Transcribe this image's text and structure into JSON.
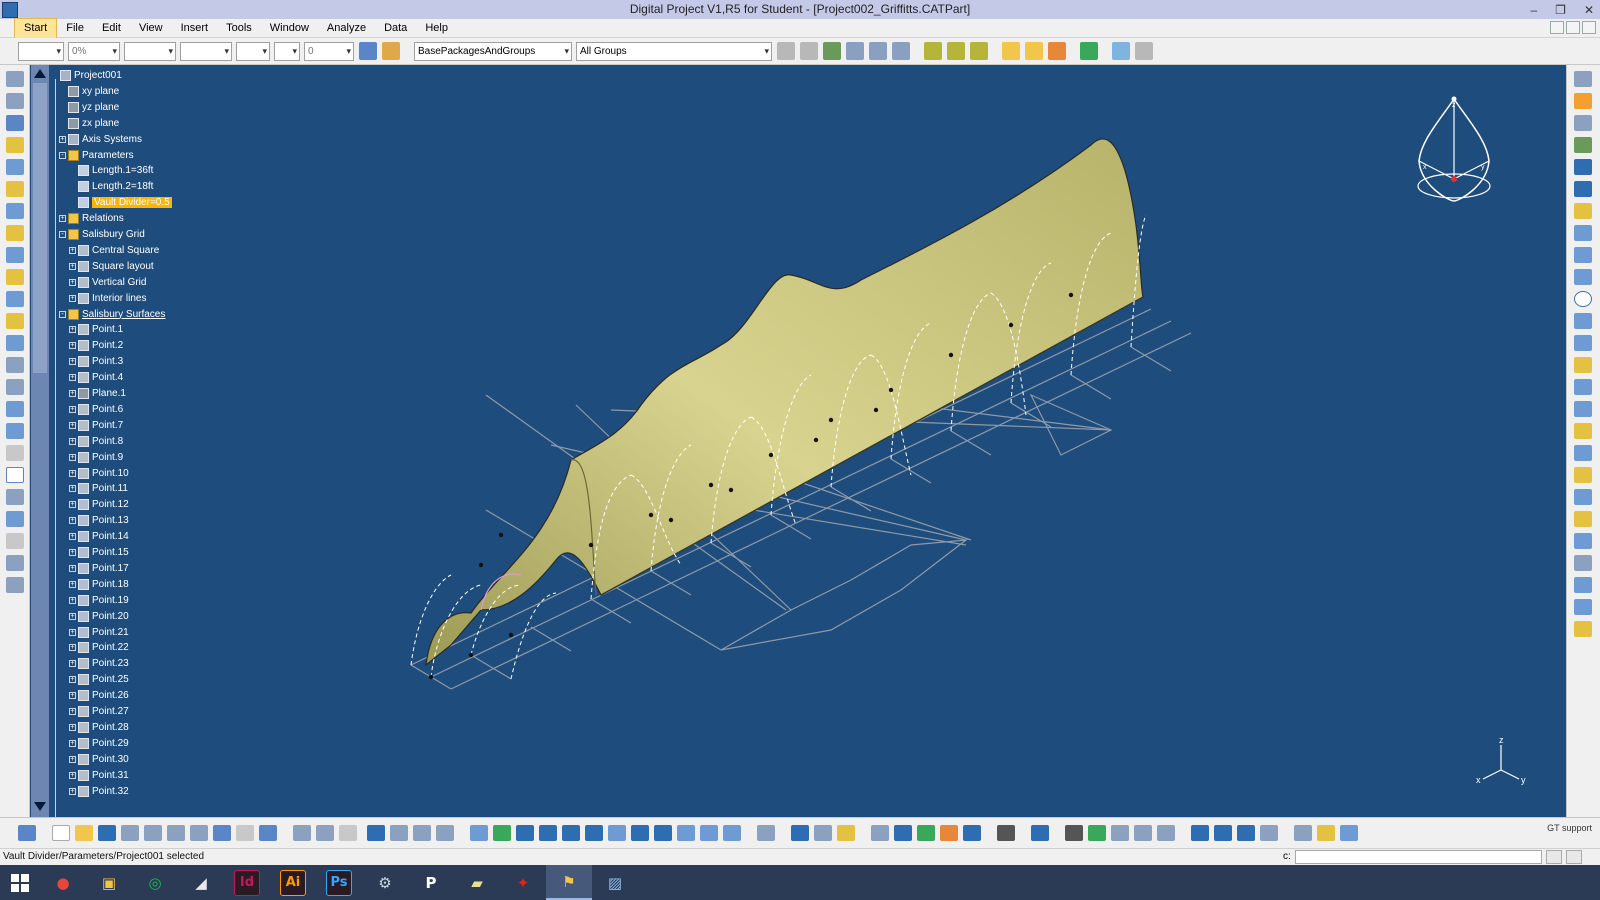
{
  "window": {
    "title": "Digital Project V1,R5 for Student - [Project002_Griffitts.CATPart]",
    "controls": [
      "–",
      "❐",
      "✕"
    ]
  },
  "menu": {
    "items": [
      "Start",
      "File",
      "Edit",
      "View",
      "Insert",
      "Tools",
      "Window",
      "Analyze",
      "Data",
      "Help"
    ]
  },
  "toolbar": {
    "percent": "0%",
    "number": "0",
    "package_combo": "BasePackagesAndGroups",
    "group_combo": "All Groups"
  },
  "tree": {
    "nodes": [
      {
        "label": "Project001",
        "level": 0,
        "icon": "part",
        "expand": ""
      },
      {
        "label": "xy plane",
        "level": 1,
        "icon": "plane",
        "expand": ""
      },
      {
        "label": "yz plane",
        "level": 1,
        "icon": "plane",
        "expand": ""
      },
      {
        "label": "zx plane",
        "level": 1,
        "icon": "plane",
        "expand": ""
      },
      {
        "label": "Axis Systems",
        "level": 1,
        "icon": "axis",
        "expand": "+"
      },
      {
        "label": "Parameters",
        "level": 1,
        "icon": "folder",
        "expand": "-"
      },
      {
        "label": "Length.1=36ft",
        "level": 2,
        "icon": "param",
        "expand": ""
      },
      {
        "label": "Length.2=18ft",
        "level": 2,
        "icon": "param",
        "expand": ""
      },
      {
        "label": "Vault Divider=0.5",
        "level": 2,
        "icon": "param",
        "expand": "",
        "selected": true
      },
      {
        "label": "Relations",
        "level": 1,
        "icon": "folder",
        "expand": "+"
      },
      {
        "label": "Salisbury Grid",
        "level": 1,
        "icon": "folder",
        "expand": "-"
      },
      {
        "label": "Central Square",
        "level": 2,
        "icon": "point",
        "expand": "+"
      },
      {
        "label": "Square layout",
        "level": 2,
        "icon": "point",
        "expand": "+"
      },
      {
        "label": "Vertical Grid",
        "level": 2,
        "icon": "point",
        "expand": "+"
      },
      {
        "label": "Interior lines",
        "level": 2,
        "icon": "point",
        "expand": "+"
      },
      {
        "label": "Salisbury Surfaces",
        "level": 1,
        "icon": "folder",
        "expand": "-",
        "underline": true
      },
      {
        "label": "Point.1",
        "level": 2,
        "icon": "point",
        "expand": "+"
      },
      {
        "label": "Point.2",
        "level": 2,
        "icon": "point",
        "expand": "+"
      },
      {
        "label": "Point.3",
        "level": 2,
        "icon": "point",
        "expand": "+"
      },
      {
        "label": "Point.4",
        "level": 2,
        "icon": "point",
        "expand": "+"
      },
      {
        "label": "Plane.1",
        "level": 2,
        "icon": "plane",
        "expand": "+"
      },
      {
        "label": "Point.6",
        "level": 2,
        "icon": "point",
        "expand": "+"
      },
      {
        "label": "Point.7",
        "level": 2,
        "icon": "point",
        "expand": "+"
      },
      {
        "label": "Point.8",
        "level": 2,
        "icon": "point",
        "expand": "+"
      },
      {
        "label": "Point.9",
        "level": 2,
        "icon": "point",
        "expand": "+"
      },
      {
        "label": "Point.10",
        "level": 2,
        "icon": "point",
        "expand": "+"
      },
      {
        "label": "Point.11",
        "level": 2,
        "icon": "point",
        "expand": "+"
      },
      {
        "label": "Point.12",
        "level": 2,
        "icon": "point",
        "expand": "+"
      },
      {
        "label": "Point.13",
        "level": 2,
        "icon": "point",
        "expand": "+"
      },
      {
        "label": "Point.14",
        "level": 2,
        "icon": "point",
        "expand": "+"
      },
      {
        "label": "Point.15",
        "level": 2,
        "icon": "point",
        "expand": "+"
      },
      {
        "label": "Point.17",
        "level": 2,
        "icon": "point",
        "expand": "+"
      },
      {
        "label": "Point.18",
        "level": 2,
        "icon": "point",
        "expand": "+"
      },
      {
        "label": "Point.19",
        "level": 2,
        "icon": "point",
        "expand": "+"
      },
      {
        "label": "Point.20",
        "level": 2,
        "icon": "point",
        "expand": "+"
      },
      {
        "label": "Point.21",
        "level": 2,
        "icon": "point",
        "expand": "+"
      },
      {
        "label": "Point.22",
        "level": 2,
        "icon": "point",
        "expand": "+"
      },
      {
        "label": "Point.23",
        "level": 2,
        "icon": "point",
        "expand": "+"
      },
      {
        "label": "Point.25",
        "level": 2,
        "icon": "point",
        "expand": "+"
      },
      {
        "label": "Point.26",
        "level": 2,
        "icon": "point",
        "expand": "+"
      },
      {
        "label": "Point.27",
        "level": 2,
        "icon": "point",
        "expand": "+"
      },
      {
        "label": "Point.28",
        "level": 2,
        "icon": "point",
        "expand": "+"
      },
      {
        "label": "Point.29",
        "level": 2,
        "icon": "point",
        "expand": "+"
      },
      {
        "label": "Point.30",
        "level": 2,
        "icon": "point",
        "expand": "+"
      },
      {
        "label": "Point.31",
        "level": 2,
        "icon": "point",
        "expand": "+"
      },
      {
        "label": "Point.32",
        "level": 2,
        "icon": "point",
        "expand": "+"
      }
    ]
  },
  "compass": {
    "z": "z",
    "x": "x",
    "y": "y"
  },
  "axes": {
    "z": "z",
    "x": "x",
    "y": "y"
  },
  "bottom": {
    "gt_support": "GT support"
  },
  "status": {
    "message": "Vault Divider/Parameters/Project001 selected",
    "command_label": "c:",
    "command_value": ""
  },
  "taskbar": {
    "apps": [
      {
        "name": "chrome",
        "glyph": "●",
        "color": "#e8453c"
      },
      {
        "name": "file-explorer",
        "glyph": "▣",
        "color": "#f4c542"
      },
      {
        "name": "spotify",
        "glyph": "◎",
        "color": "#1db954"
      },
      {
        "name": "rhino",
        "glyph": "◢",
        "color": "#e8e8e8"
      },
      {
        "name": "indesign",
        "glyph": "Id",
        "color": "#c2185b"
      },
      {
        "name": "illustrator",
        "glyph": "Ai",
        "color": "#ff9a00"
      },
      {
        "name": "photoshop",
        "glyph": "Ps",
        "color": "#31a8ff"
      },
      {
        "name": "steam",
        "glyph": "⚙",
        "color": "#c7d5e0"
      },
      {
        "name": "pandora",
        "glyph": "P",
        "color": "#ffffff"
      },
      {
        "name": "notes",
        "glyph": "▰",
        "color": "#e8e28c"
      },
      {
        "name": "acrobat",
        "glyph": "✦",
        "color": "#e2231a"
      },
      {
        "name": "digital-project",
        "glyph": "⚑",
        "color": "#f2c54b",
        "active": true
      },
      {
        "name": "photo-viewer",
        "glyph": "▨",
        "color": "#8ec3f0"
      }
    ]
  },
  "colors": {
    "viewport_bg": "#1e4c7c",
    "surface": "#c7c27a",
    "grid_line": "#8e9aa8",
    "selection": "#ffb400",
    "titlebar": "#c5c9e8"
  }
}
